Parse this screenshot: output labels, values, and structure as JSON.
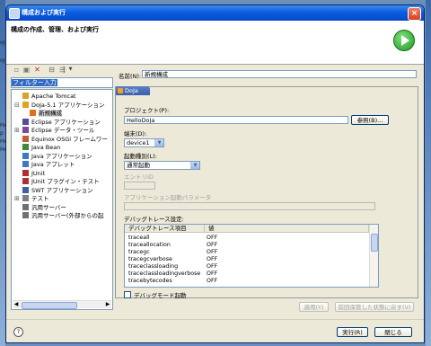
{
  "background_text": [
    "oJa",
    "oJa",
    "Hel",
    "p",
    "Hel",
    "Hel"
  ],
  "window": {
    "title": "構成および実行",
    "header_title": "構成の作成、管理、および実行",
    "close_glyph": "×"
  },
  "left_panel": {
    "filter_text": "フィルター入力",
    "tree": [
      {
        "label": "Apache Tomcat",
        "level": 1,
        "icon": "tomcat-icon",
        "color": "#d9a22a",
        "expander": ""
      },
      {
        "label": "DoJa-5.1 アプリケーション",
        "level": 1,
        "icon": "doja-icon",
        "color": "#e0a020",
        "expander": "⊟"
      },
      {
        "label": "新規構成",
        "level": 2,
        "icon": "config-icon",
        "color": "#e07020",
        "expander": "",
        "selected": true
      },
      {
        "label": "Eclipse アプリケーション",
        "level": 1,
        "icon": "eclipse-icon",
        "color": "#5a4a9a",
        "expander": ""
      },
      {
        "label": "Eclipse データ・ツール",
        "level": 1,
        "icon": "data-tool-icon",
        "color": "#7a4aa0",
        "expander": "⊞"
      },
      {
        "label": "Equinox OSGi フレームワー",
        "level": 1,
        "icon": "osgi-icon",
        "color": "#c06030",
        "expander": ""
      },
      {
        "label": "Java Bean",
        "level": 1,
        "icon": "java-bean-icon",
        "color": "#3a8a3a",
        "expander": ""
      },
      {
        "label": "Java アプリケーション",
        "level": 1,
        "icon": "java-app-icon",
        "color": "#3a7ac0",
        "expander": ""
      },
      {
        "label": "Java アプレット",
        "level": 1,
        "icon": "applet-icon",
        "color": "#3a7ac0",
        "expander": ""
      },
      {
        "label": "JUnit",
        "level": 1,
        "icon": "junit-icon",
        "color": "#b03030",
        "expander": ""
      },
      {
        "label": "JUnit プラグイン・テスト",
        "level": 1,
        "icon": "junit-plugin-icon",
        "color": "#b03030",
        "expander": ""
      },
      {
        "label": "SWT アプリケーション",
        "level": 1,
        "icon": "swt-icon",
        "color": "#4060a0",
        "expander": ""
      },
      {
        "label": "テスト",
        "level": 1,
        "icon": "test-icon",
        "color": "#808080",
        "expander": "⊞"
      },
      {
        "label": "汎用サーバー",
        "level": 1,
        "icon": "server-icon",
        "color": "#707070",
        "expander": ""
      },
      {
        "label": "汎用サーバー(外部からの起",
        "level": 1,
        "icon": "server-external-icon",
        "color": "#707070",
        "expander": ""
      }
    ],
    "scroll_left": "◀",
    "scroll_right": "▶"
  },
  "form": {
    "name_label": "名前(N):",
    "name_value": "新規構成",
    "tab_label": "DoJa",
    "project_label": "プロジェクト(P):",
    "project_value": "HelloDoJa",
    "browse_button": "参照(B)...",
    "device_label": "端末(D):",
    "device_value": "device1",
    "launch_type_label": "起動種別(L):",
    "launch_type_value": "通常起動",
    "entry_id_label": "エントリID",
    "entry_id_value": "",
    "app_param_label": "アプリケーション起動パラメータ",
    "app_param_value": "",
    "debug_trace_label": "デバッグトレース設定:",
    "trace_columns": [
      "デバッグトレース項目",
      "値"
    ],
    "trace_rows": [
      [
        "traceall",
        "OFF"
      ],
      [
        "traceallocation",
        "OFF"
      ],
      [
        "tracegc",
        "OFF"
      ],
      [
        "tracegcverbose",
        "OFF"
      ],
      [
        "traceclassloading",
        "OFF"
      ],
      [
        "traceclassloadingverbose",
        "OFF"
      ],
      [
        "tracebytecodes",
        "OFF"
      ]
    ],
    "debug_mode_label": "デバッグモード起動",
    "debug_mode_checked": false,
    "apply_button": "適用(Y)",
    "revert_button": "前回保管した状態に戻す(V)"
  },
  "footer": {
    "help_glyph": "?",
    "run_button": "実行(R)",
    "close_button": "閉じる"
  },
  "colors": {
    "titlebar": "#0a5de0",
    "selection": "#316ac5",
    "run_green": "#1f9a24",
    "tab_blue": "#3a5fa8"
  }
}
